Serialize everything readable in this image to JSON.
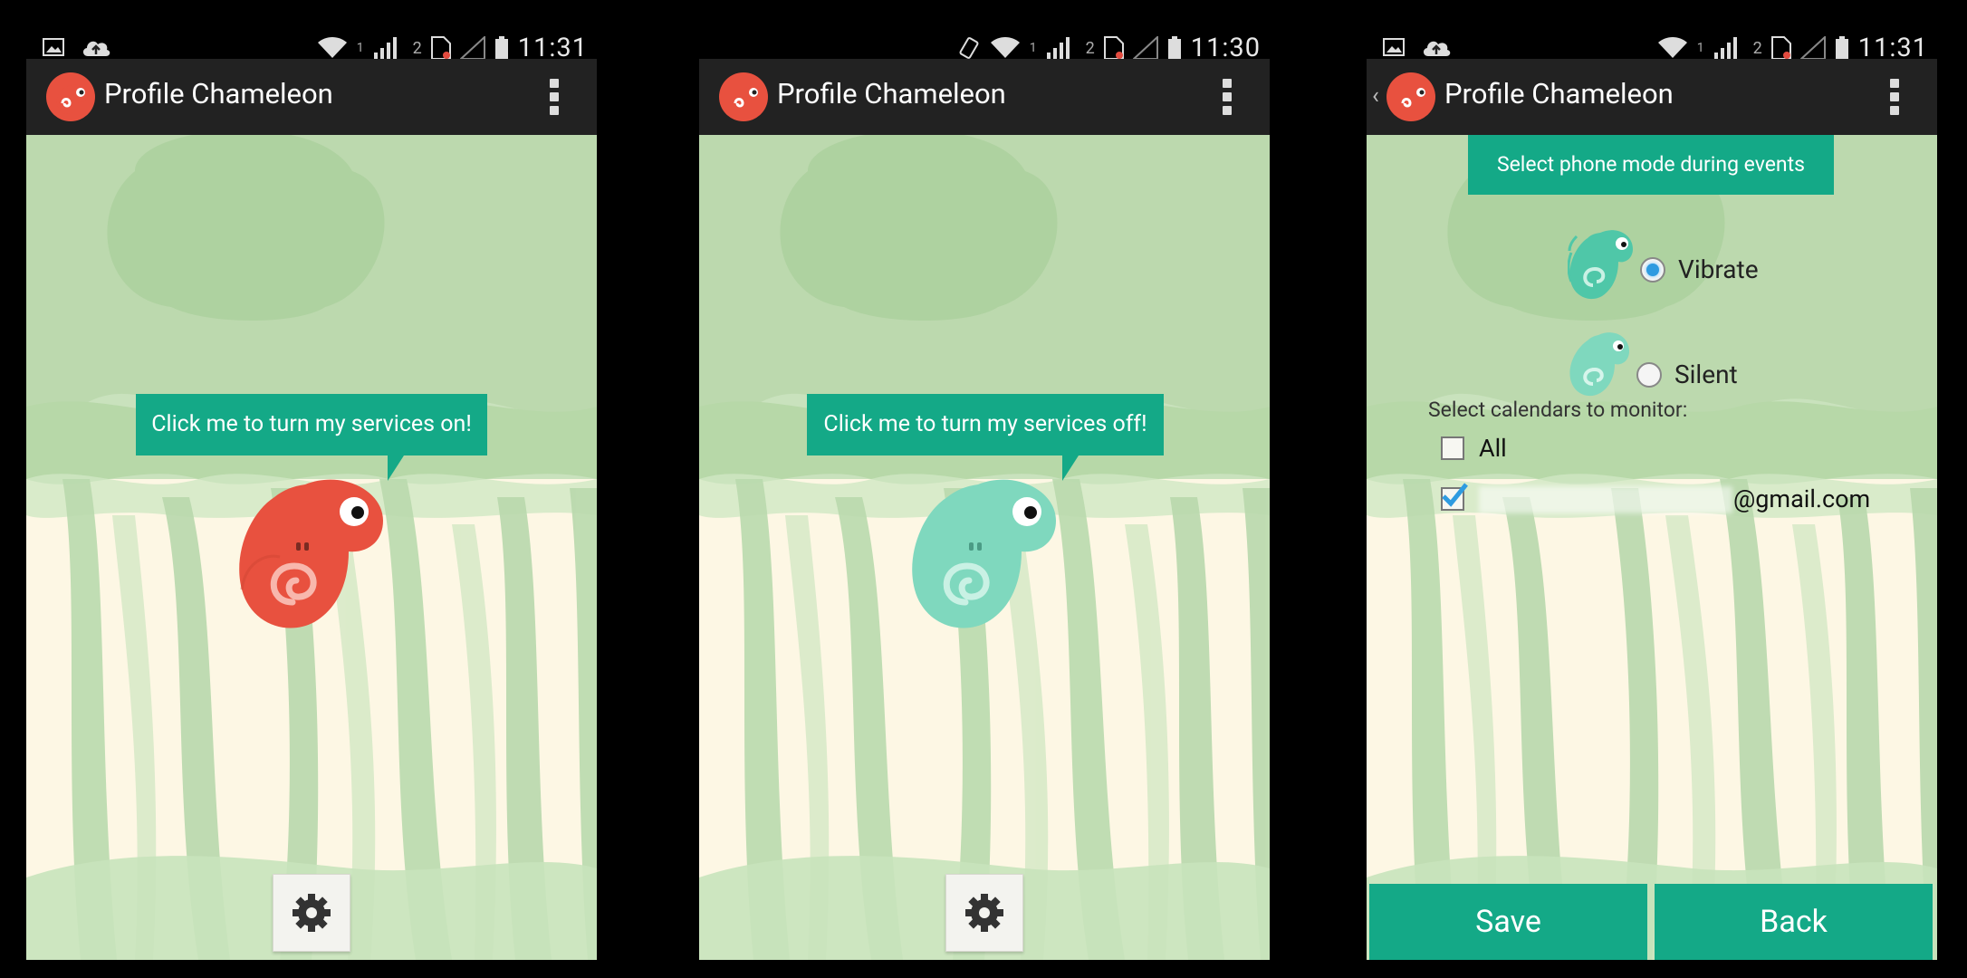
{
  "screens": [
    {
      "status": {
        "time": "11:31",
        "sim_label": "2",
        "signal_label": "1"
      },
      "app_title": "Profile Chameleon",
      "bubble_text": "Click me to turn my services on!",
      "chameleon_color": "#e8513f"
    },
    {
      "status": {
        "time": "11:30",
        "sim_label": "2",
        "signal_label": "1"
      },
      "app_title": "Profile Chameleon",
      "bubble_text": "Click me to turn my services off!",
      "chameleon_color": "#7fd8be"
    },
    {
      "status": {
        "time": "11:31",
        "sim_label": "2",
        "signal_label": "1"
      },
      "app_title": "Profile Chameleon",
      "banner_text": "Select phone mode during events",
      "modes": [
        {
          "label": "Vibrate",
          "selected": true
        },
        {
          "label": "Silent",
          "selected": false
        }
      ],
      "calendars_label": "Select calendars to monitor:",
      "calendars": [
        {
          "label": "All",
          "checked": false
        },
        {
          "label": "@gmail.com",
          "checked": true
        }
      ],
      "save_label": "Save",
      "back_label": "Back"
    }
  ],
  "colors": {
    "accent": "#14a987",
    "actionbar": "#222222",
    "logo_red": "#e8513f",
    "chameleon_teal": "#7fd8be"
  },
  "icons": [
    "image-icon",
    "cloud-upload-icon",
    "wifi-icon",
    "signal-icon",
    "sim-card-icon",
    "battery-icon",
    "vibrate-icon",
    "overflow-menu-icon",
    "gear-icon",
    "chameleon-logo-icon"
  ]
}
